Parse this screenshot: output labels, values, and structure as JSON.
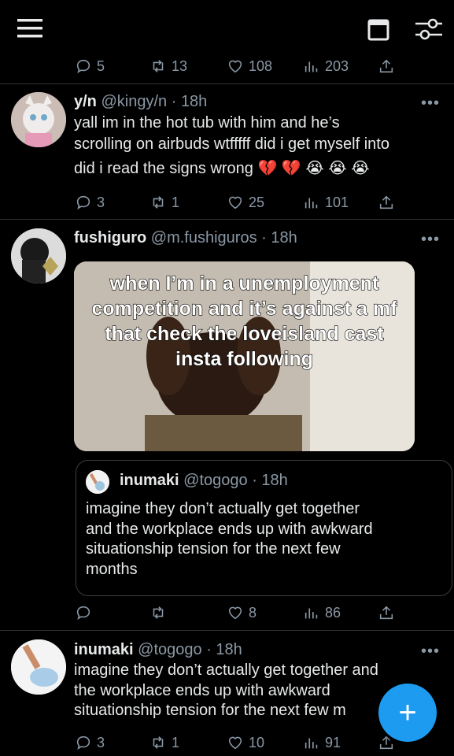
{
  "colors": {
    "background": "#000000",
    "text": "#e7e9ea",
    "muted": "#8b98a5",
    "accent": "#1d9bf0",
    "divider": "#2f3336"
  },
  "topbar": {
    "icons": [
      "menu-icon",
      "calendar-icon",
      "filter-sliders-icon"
    ]
  },
  "top_actions": {
    "replies": "5",
    "retweets": "13",
    "likes": "108",
    "views": "203"
  },
  "tweets": [
    {
      "name": "y/n",
      "handle": "@kingy/n",
      "dot": "·",
      "time": "18h",
      "text_lines": [
        "yall im in the hot tub with him and he’s",
        "scrolling on airbuds wtfffff did i get myself into",
        "did i read the signs wrong 💔 💔 😭 😭 😭"
      ],
      "actions": {
        "replies": "3",
        "retweets": "1",
        "likes": "25",
        "views": "101"
      }
    },
    {
      "name": "fushiguro",
      "handle": "@m.fushiguros",
      "dot": "·",
      "time": "18h",
      "media_caption": [
        "when I’m in a unemployment",
        "competition and it’s against a mf",
        "that check the loveisland cast",
        "insta following"
      ],
      "quote": {
        "name": "inumaki",
        "handle": "@togogo",
        "dot": "·",
        "time": "18h",
        "text_lines": [
          "imagine they don’t actually get together",
          "and the workplace ends up with awkward",
          "situationship tension for the next few",
          "months"
        ]
      },
      "actions": {
        "replies": "",
        "retweets": "",
        "likes": "8",
        "views": "86"
      }
    },
    {
      "name": "inumaki",
      "handle": "@togogo",
      "dot": "·",
      "time": "18h",
      "text_lines": [
        "imagine they don’t actually get together and",
        "the workplace ends up with awkward",
        "situationship tension for the next few m"
      ],
      "actions": {
        "replies": "3",
        "retweets": "1",
        "likes": "10",
        "views": "91"
      }
    }
  ],
  "more_label": "•••",
  "fab": {
    "label": "+",
    "icon": "plus-icon"
  }
}
